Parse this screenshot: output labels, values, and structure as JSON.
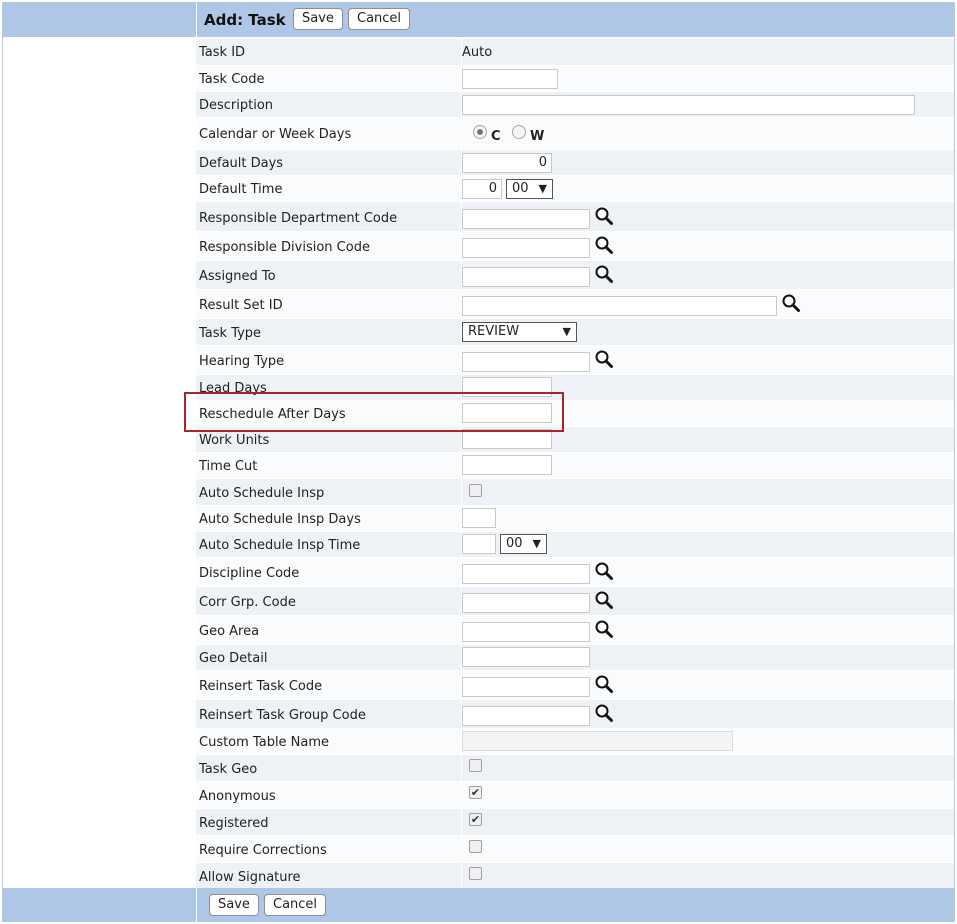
{
  "header": {
    "title": "Add: Task",
    "save_label": "Save",
    "cancel_label": "Cancel"
  },
  "footer": {
    "save_label": "Save",
    "cancel_label": "Cancel"
  },
  "fields": {
    "task_id": {
      "label": "Task ID",
      "value": "Auto"
    },
    "task_code": {
      "label": "Task Code",
      "value": ""
    },
    "description": {
      "label": "Description",
      "value": ""
    },
    "calendar_or_week_days": {
      "label": "Calendar or Week Days",
      "option_c": "C",
      "option_w": "W",
      "selected": "C"
    },
    "default_days": {
      "label": "Default Days",
      "value": "0"
    },
    "default_time": {
      "label": "Default Time",
      "hour": "0",
      "minute": "00"
    },
    "responsible_department_code": {
      "label": "Responsible Department Code",
      "value": ""
    },
    "responsible_division_code": {
      "label": "Responsible Division Code",
      "value": ""
    },
    "assigned_to": {
      "label": "Assigned To",
      "value": ""
    },
    "result_set_id": {
      "label": "Result Set ID",
      "value": ""
    },
    "task_type": {
      "label": "Task Type",
      "value": "REVIEW"
    },
    "hearing_type": {
      "label": "Hearing Type",
      "value": ""
    },
    "lead_days": {
      "label": "Lead Days",
      "value": ""
    },
    "reschedule_after_days": {
      "label": "Reschedule After Days",
      "value": ""
    },
    "work_units": {
      "label": "Work Units",
      "value": ""
    },
    "time_cut": {
      "label": "Time Cut",
      "value": ""
    },
    "auto_schedule_insp": {
      "label": "Auto Schedule Insp",
      "checked": false
    },
    "auto_schedule_insp_days": {
      "label": "Auto Schedule Insp Days",
      "value": ""
    },
    "auto_schedule_insp_time": {
      "label": "Auto Schedule Insp Time",
      "hour": "",
      "minute": "00"
    },
    "discipline_code": {
      "label": "Discipline Code",
      "value": ""
    },
    "corr_grp_code": {
      "label": "Corr Grp. Code",
      "value": ""
    },
    "geo_area": {
      "label": "Geo Area",
      "value": ""
    },
    "geo_detail": {
      "label": "Geo Detail",
      "value": ""
    },
    "reinsert_task_code": {
      "label": "Reinsert Task Code",
      "value": ""
    },
    "reinsert_task_group_code": {
      "label": "Reinsert Task Group Code",
      "value": ""
    },
    "custom_table_name": {
      "label": "Custom Table Name",
      "value": ""
    },
    "task_geo": {
      "label": "Task Geo",
      "checked": false
    },
    "anonymous": {
      "label": "Anonymous",
      "checked": true
    },
    "registered": {
      "label": "Registered",
      "checked": true
    },
    "require_corrections": {
      "label": "Require Corrections",
      "checked": false
    },
    "allow_signature": {
      "label": "Allow Signature",
      "checked": false
    }
  },
  "icons": {
    "lookup": "magnifier-icon",
    "dropdown": "dropdown-arrow-icon",
    "check": "checkmark-icon"
  },
  "colors": {
    "header_bar": "#afc7e6",
    "row_shade": "#eef1f6",
    "highlight_border": "#a8262a"
  }
}
